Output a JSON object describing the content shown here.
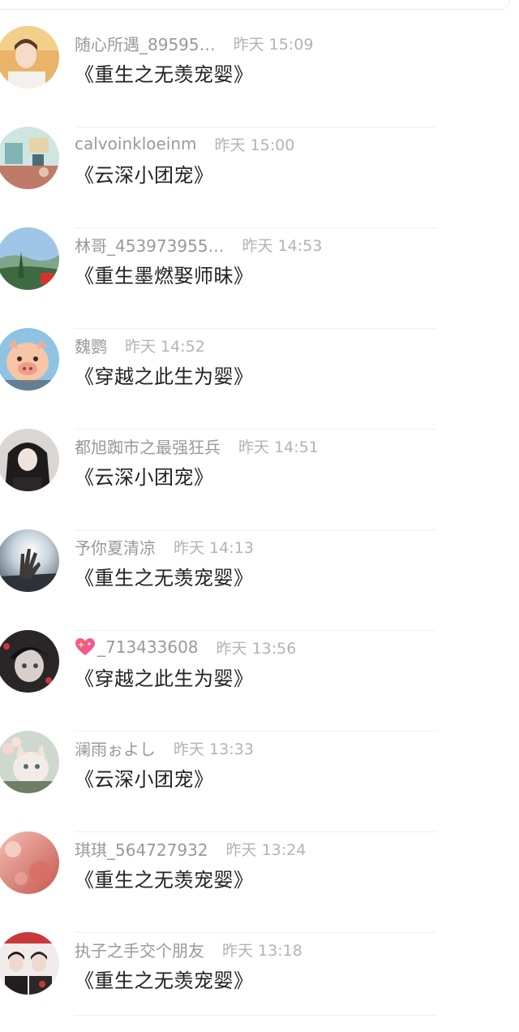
{
  "comments": [
    {
      "username": "随心所遇_89595…",
      "time": "昨天 15:09",
      "message": "《重生之无羡宠婴》",
      "avatar": "woman-face-avatar"
    },
    {
      "username": "calvoinkloeinm",
      "time": "昨天 15:00",
      "message": "《云深小团宠》",
      "avatar": "desk-room-avatar"
    },
    {
      "username": "林哥_453973955…",
      "time": "昨天 14:53",
      "message": "《重生墨燃娶师昧》",
      "avatar": "mountain-landscape-avatar"
    },
    {
      "username": "魏鹦",
      "time": "昨天 14:52",
      "message": "《穿越之此生为婴》",
      "avatar": "cartoon-pig-avatar"
    },
    {
      "username": "都旭踟市之最强狂兵",
      "time": "昨天 14:51",
      "message": "《云深小团宠》",
      "avatar": "dark-hair-girl-avatar"
    },
    {
      "username": "予你夏清凉",
      "time": "昨天 14:13",
      "message": "《重生之无羡宠婴》",
      "avatar": "sunlight-hand-avatar"
    },
    {
      "username": "_713433608",
      "time": "昨天 13:56",
      "message": "《穿越之此生为婴》",
      "avatar": "anime-character-avatar",
      "prefix_icon": "sparkling-heart-icon"
    },
    {
      "username": "澜雨ぉよし",
      "time": "昨天 13:33",
      "message": "《云深小团宠》",
      "avatar": "flower-cat-avatar"
    },
    {
      "username": "琪琪_564727932",
      "time": "昨天 13:24",
      "message": "《重生之无羡宠婴》",
      "avatar": "pink-blossom-avatar"
    },
    {
      "username": "执子之手交个朋友",
      "time": "昨天 13:18",
      "message": "《重生之无羡宠婴》",
      "avatar": "two-people-avatar"
    }
  ],
  "colors": {
    "username": "#999999",
    "time": "#b3b3b3",
    "message": "#222222",
    "divider": "#efefef"
  }
}
